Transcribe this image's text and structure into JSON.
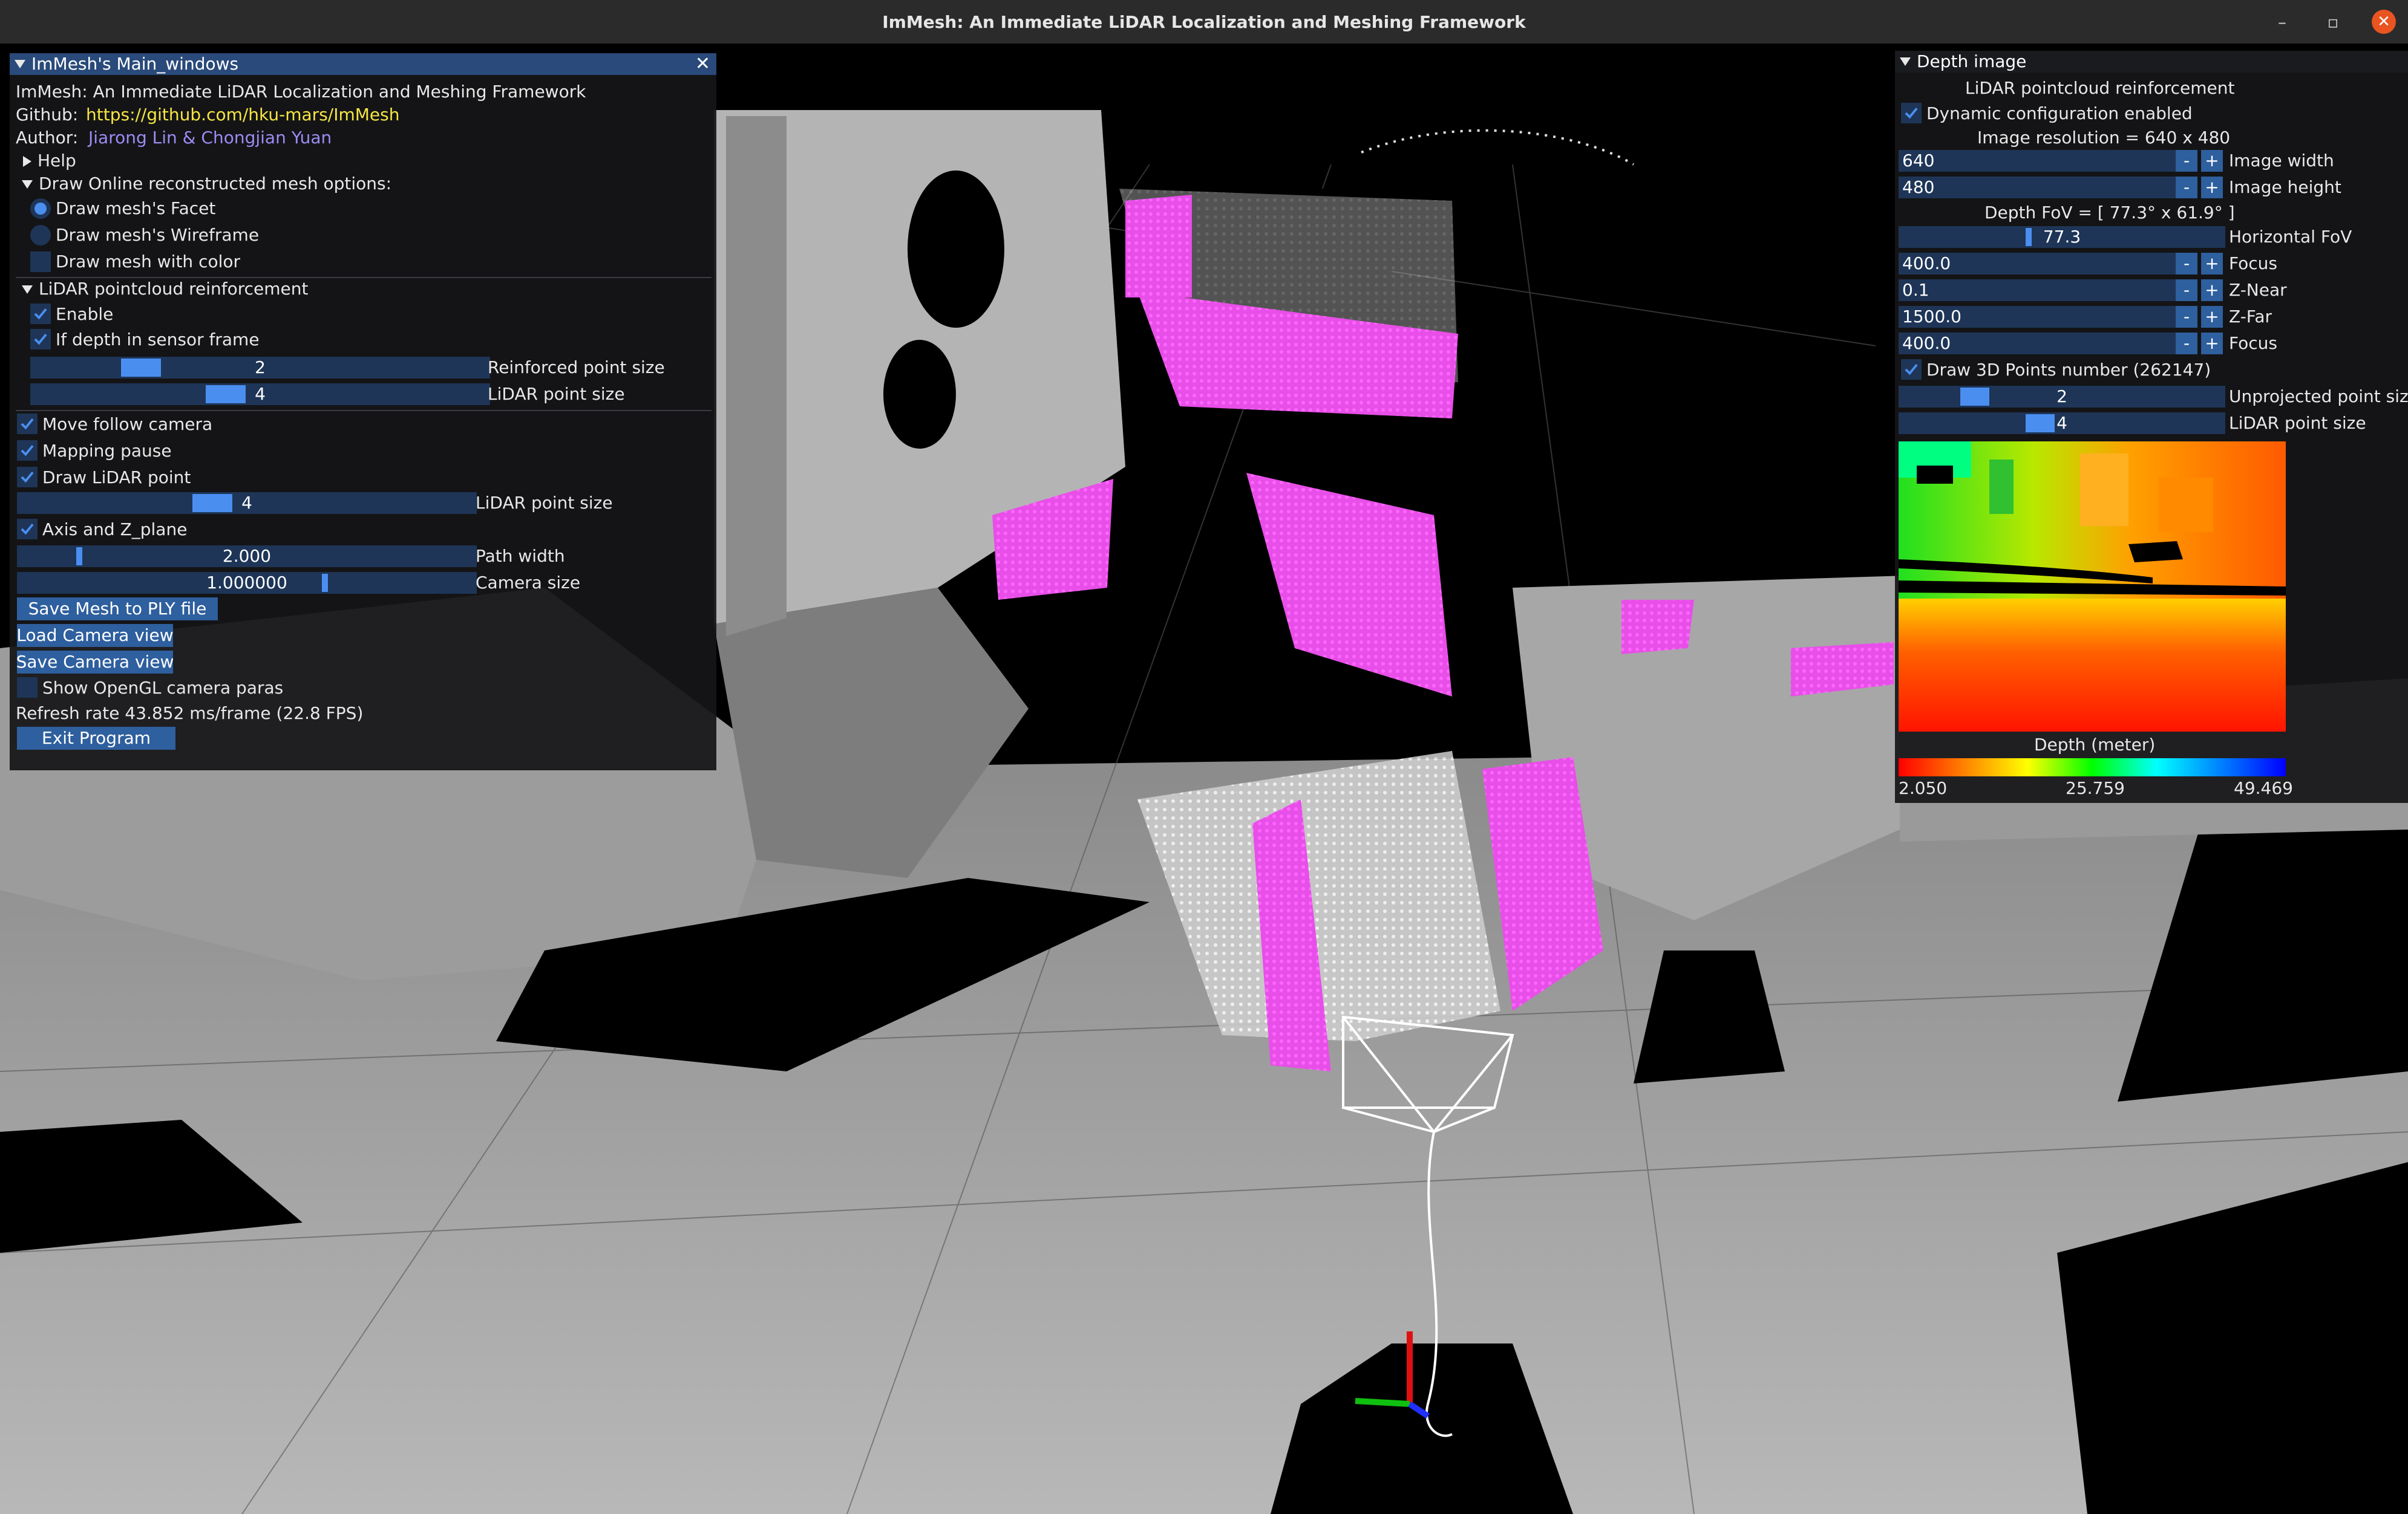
{
  "window": {
    "title": "ImMesh: An Immediate LiDAR Localization and Meshing Framework",
    "minimize": "–",
    "restore": "▫",
    "close": "✕"
  },
  "main_panel": {
    "title": "ImMesh's Main_windows",
    "desc": "ImMesh: An Immediate LiDAR Localization and Meshing Framework",
    "github_label": "Github:",
    "github_link": "https://github.com/hku-mars/ImMesh",
    "author_label": "Author:",
    "author_names": "Jiarong Lin & Chongjian Yuan",
    "help": "Help",
    "mesh_options": "Draw Online reconstructed mesh options:",
    "mesh_facet": "Draw mesh's Facet",
    "mesh_wireframe": "Draw mesh's Wireframe",
    "mesh_color": "Draw mesh with color",
    "reinforce_header": "LiDAR pointcloud reinforcement",
    "enable": "Enable",
    "depth_sensor": "If depth in sensor frame",
    "reinforced_size": "2",
    "reinforced_size_label": "Reinforced point size",
    "lidar_size_1": "4",
    "lidar_size_label": "LiDAR point size",
    "move_follow": "Move follow camera",
    "mapping_pause": "Mapping pause",
    "draw_lidar": "Draw LiDAR point",
    "lidar_size_2": "4",
    "axis_zplane": "Axis and Z_plane",
    "path_width": "2.000",
    "path_width_label": "Path width",
    "camera_size": "1.000000",
    "camera_size_label": "Camera size",
    "save_mesh": "Save Mesh to PLY file",
    "load_camera": "Load Camera view",
    "save_camera": "Save Camera view",
    "show_opengl": "Show OpenGL camera paras",
    "refresh_rate": "Refresh rate 43.852 ms/frame (22.8 FPS)",
    "exit": "Exit Program"
  },
  "depth_panel": {
    "title": "Depth image",
    "reinforce_label": "LiDAR pointcloud reinforcement",
    "dynamic_config": "Dynamic configuration enabled",
    "resolution": "Image resolution = 640 x 480",
    "image_width": "640",
    "image_width_label": "Image width",
    "image_height": "480",
    "image_height_label": "Image height",
    "fov_label": "Depth FoV = [ 77.3° x 61.9° ]",
    "h_fov": "77.3",
    "h_fov_label": "Horizontal FoV",
    "focus1": "400.0",
    "focus_label": "Focus",
    "znear": "0.1",
    "znear_label": "Z-Near",
    "zfar": "1500.0",
    "zfar_label": "Z-Far",
    "focus2": "400.0",
    "draw3d": "Draw 3D Points  number (262147)",
    "unproj_size": "2",
    "unproj_label": "Unprojected point size",
    "lidar_size": "4",
    "lidar_label": "LiDAR point size",
    "depth_label": "Depth (meter)",
    "depth_min": "2.050",
    "depth_mid": "25.759",
    "depth_max": "49.469",
    "minus": "-",
    "plus": "+"
  },
  "colors": {
    "header": "#294a7a",
    "accent": "#4a8ef0",
    "frame": "#1e3557",
    "link_yellow": "#f5e642",
    "link_purple": "#9b8cf5",
    "lidar_points": "#ff33ff"
  }
}
